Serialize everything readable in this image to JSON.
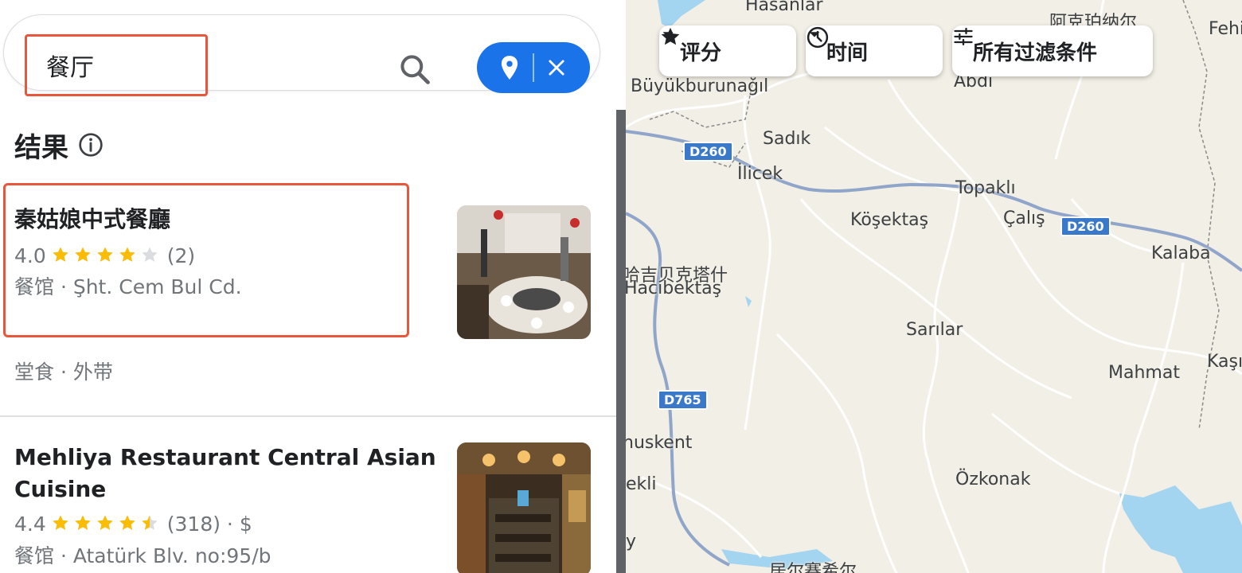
{
  "search": {
    "value": "餐厅",
    "colors": {
      "accent": "#1a73e8",
      "highlight_border": "#e8563b"
    }
  },
  "results": {
    "heading": "结果",
    "items": [
      {
        "title": "秦姑娘中式餐廳",
        "rating": "4.0",
        "stars": 4.0,
        "reviews": "(2)",
        "category_address": "餐馆 · Şht. Cem Bul Cd.",
        "services": "堂食 · 外带"
      },
      {
        "title_line1": "Mehliya Restaurant Central Asian",
        "title_line2": "Cuisine",
        "rating": "4.4",
        "stars": 4.5,
        "reviews": "(318) · $",
        "category_address": "餐馆 · Atatürk Blv. no:95/b"
      }
    ]
  },
  "filters": {
    "rating": "评分",
    "hours": "时间",
    "all_filters": "所有过滤条件"
  },
  "map": {
    "places": {
      "hasanlar": "Hasanlar",
      "akepinar": "阿克珀纳尔",
      "fehi": "Fehi",
      "abdi": "Abdi",
      "buyukburunagil": "Büyükburunağıl",
      "sadik": "Sadık",
      "ilicek": "İlicek",
      "topakli": "Topaklı",
      "kosektas": "Köşektaş",
      "calis": "Çalış",
      "kalaba": "Kalaba",
      "hacibektas_zh": "哈吉贝克塔什",
      "hacibektas": "Hacıbektaş",
      "sarilar": "Sarılar",
      "mahmat": "Mahmat",
      "kasi": "Kaşı",
      "muskent": "nuskent",
      "ekli": "ekli",
      "ozkonak": "Özkonak",
      "y": "y",
      "bottom_zh": "居尔赛希尔"
    },
    "roads": {
      "d260_a": "D260",
      "d260_b": "D260",
      "d765": "D765"
    }
  }
}
